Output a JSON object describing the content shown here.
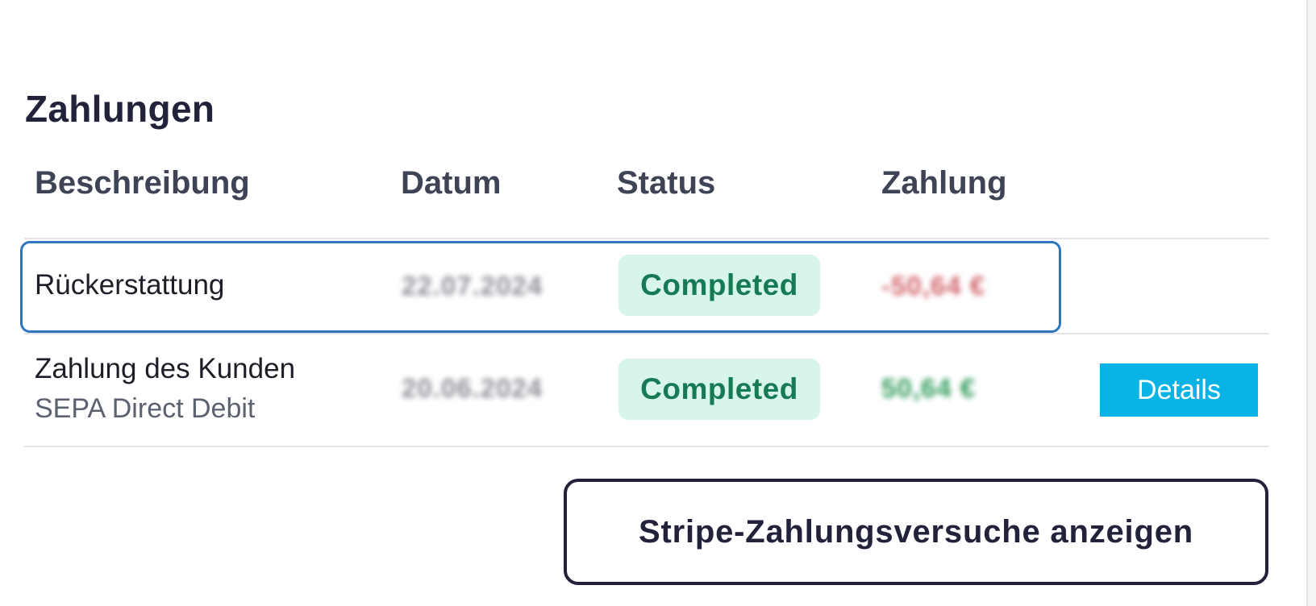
{
  "section": {
    "title": "Zahlungen"
  },
  "table": {
    "headers": [
      "Beschreibung",
      "Datum",
      "Status",
      "Zahlung"
    ],
    "rows": [
      {
        "description": "Rückerstattung",
        "subtitle": "",
        "date": "22.07.2024",
        "status": "Completed",
        "amount": "-50,64 €",
        "amount_color": "#d1626a",
        "action": ""
      },
      {
        "description": "Zahlung des Kunden",
        "subtitle": "SEPA Direct Debit",
        "date": "20.06.2024",
        "status": "Completed",
        "amount": "50,64 €",
        "amount_color": "#2f9a5a",
        "action": "Details"
      }
    ]
  },
  "footer": {
    "stripe_button_label": "Stripe-Zahlungsversuche anzeigen"
  },
  "colors": {
    "status_bg": "#d8f5ec",
    "status_text": "#167a55",
    "details_bg": "#0ab3e6",
    "highlight_border": "#2c76c0",
    "title": "#22223a"
  }
}
